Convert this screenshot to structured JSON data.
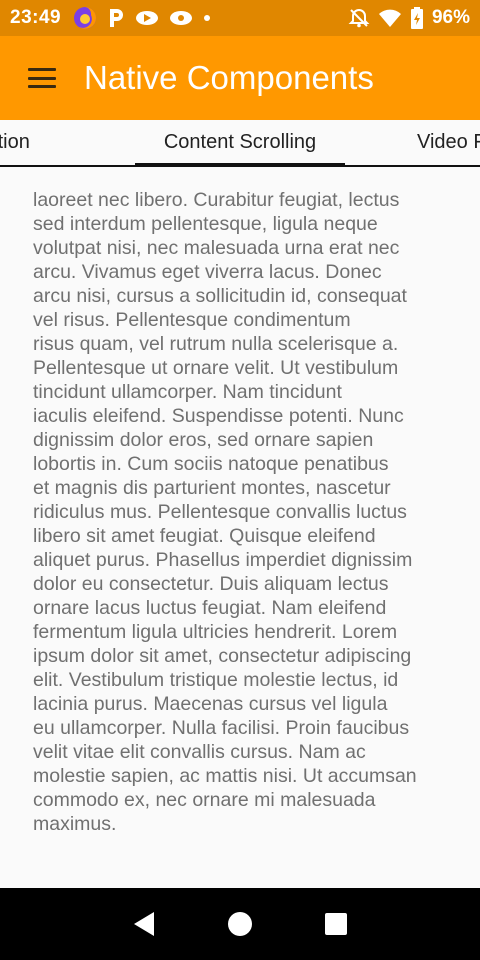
{
  "status_bar": {
    "time": "23:49",
    "battery": "96%",
    "left_icons": [
      "firefox-icon",
      "p-icon",
      "app-icon",
      "app-icon",
      "dot-icon"
    ],
    "right_icons": [
      "notifications-off-icon",
      "wifi-icon",
      "battery-icon"
    ],
    "color": "#e08700"
  },
  "app_bar": {
    "title": "Native Components",
    "color": "#ff9800",
    "menu_icon": "menu-icon"
  },
  "tabs": [
    {
      "label": "lection"
    },
    {
      "label": "Content Scrolling",
      "selected": true
    },
    {
      "label": "Video F"
    }
  ],
  "content": {
    "lines": [
      "laoreet nec libero. Curabitur feugiat, lectus",
      "sed interdum pellentesque, ligula neque",
      "volutpat nisi, nec malesuada urna erat nec",
      "arcu. Vivamus eget viverra lacus. Donec",
      "arcu nisi, cursus a sollicitudin id, consequat",
      "vel risus. Pellentesque condimentum",
      "risus quam, vel rutrum nulla scelerisque a.",
      "Pellentesque ut ornare velit. Ut vestibulum",
      "tincidunt ullamcorper. Nam tincidunt",
      "iaculis eleifend. Suspendisse potenti. Nunc",
      "dignissim dolor eros, sed ornare sapien",
      "lobortis in. Cum sociis natoque penatibus",
      "et magnis dis parturient montes, nascetur",
      "ridiculus mus. Pellentesque convallis luctus",
      "libero sit amet feugiat. Quisque eleifend",
      "aliquet purus. Phasellus imperdiet dignissim",
      "dolor eu consectetur. Duis aliquam lectus",
      "ornare lacus luctus feugiat. Nam eleifend",
      "fermentum ligula ultricies hendrerit. Lorem",
      "ipsum dolor sit amet, consectetur adipiscing",
      "elit. Vestibulum tristique molestie lectus, id",
      "lacinia purus. Maecenas cursus vel ligula",
      "eu ullamcorper. Nulla facilisi. Proin faucibus",
      "velit vitae elit convallis cursus. Nam ac",
      "molestie sapien, ac mattis nisi. Ut accumsan",
      "commodo ex, nec ornare mi malesuada",
      "maximus."
    ]
  },
  "nav_bar": {
    "buttons": [
      "back-icon",
      "home-icon",
      "recents-icon"
    ]
  }
}
